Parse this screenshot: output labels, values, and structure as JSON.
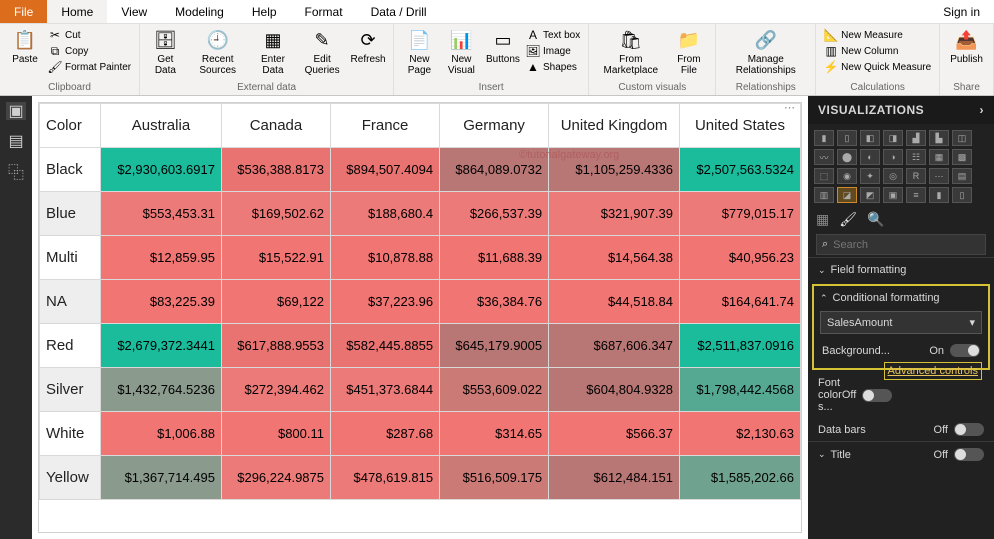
{
  "tabs": {
    "file": "File",
    "home": "Home",
    "view": "View",
    "modeling": "Modeling",
    "help": "Help",
    "format": "Format",
    "datadrill": "Data / Drill",
    "signin": "Sign in"
  },
  "ribbon": {
    "clipboard": {
      "paste": "Paste",
      "cut": "Cut",
      "copy": "Copy",
      "painter": "Format Painter",
      "label": "Clipboard"
    },
    "external": {
      "getdata": "Get\nData",
      "recent": "Recent\nSources",
      "enter": "Enter\nData",
      "edit": "Edit\nQueries",
      "refresh": "Refresh",
      "label": "External data"
    },
    "insert": {
      "newpage": "New\nPage",
      "newvisual": "New\nVisual",
      "buttons": "Buttons",
      "textbox": "Text box",
      "image": "Image",
      "shapes": "Shapes",
      "label": "Insert"
    },
    "custom": {
      "marketplace": "From\nMarketplace",
      "fromfile": "From\nFile",
      "label": "Custom visuals"
    },
    "rel": {
      "manage": "Manage\nRelationships",
      "label": "Relationships"
    },
    "calc": {
      "measure": "New Measure",
      "column": "New Column",
      "quick": "New Quick Measure",
      "label": "Calculations"
    },
    "share": {
      "publish": "Publish",
      "label": "Share"
    }
  },
  "matrix": {
    "corner": "Color",
    "columns": [
      "Australia",
      "Canada",
      "France",
      "Germany",
      "United Kingdom",
      "United States"
    ],
    "rows": [
      {
        "label": "Black",
        "cells": [
          {
            "v": "$2,930,603.6917",
            "c": "#1abc9c"
          },
          {
            "v": "$536,388.8173",
            "c": "#e97371"
          },
          {
            "v": "$894,507.4094",
            "c": "#e97371"
          },
          {
            "v": "$864,089.0732",
            "c": "#b87775"
          },
          {
            "v": "$1,105,259.4336",
            "c": "#b87775"
          },
          {
            "v": "$2,507,563.5324",
            "c": "#1abc9c"
          }
        ]
      },
      {
        "label": "Blue",
        "cells": [
          {
            "v": "$553,453.31",
            "c": "#ec7a78"
          },
          {
            "v": "$169,502.62",
            "c": "#ec7a78"
          },
          {
            "v": "$188,680.4",
            "c": "#ec7a78"
          },
          {
            "v": "$266,537.39",
            "c": "#ec7a78"
          },
          {
            "v": "$321,907.39",
            "c": "#ec7a78"
          },
          {
            "v": "$779,015.17",
            "c": "#ec7a78"
          }
        ]
      },
      {
        "label": "Multi",
        "cells": [
          {
            "v": "$12,859.95",
            "c": "#f07573"
          },
          {
            "v": "$15,522.91",
            "c": "#f07573"
          },
          {
            "v": "$10,878.88",
            "c": "#f07573"
          },
          {
            "v": "$11,688.39",
            "c": "#f07573"
          },
          {
            "v": "$14,564.38",
            "c": "#f07573"
          },
          {
            "v": "$40,956.23",
            "c": "#f07573"
          }
        ]
      },
      {
        "label": "NA",
        "cells": [
          {
            "v": "$83,225.39",
            "c": "#f07573"
          },
          {
            "v": "$69,122",
            "c": "#f07573"
          },
          {
            "v": "$37,223.96",
            "c": "#f07573"
          },
          {
            "v": "$36,384.76",
            "c": "#f07573"
          },
          {
            "v": "$44,518.84",
            "c": "#f07573"
          },
          {
            "v": "$164,641.74",
            "c": "#f07573"
          }
        ]
      },
      {
        "label": "Red",
        "cells": [
          {
            "v": "$2,679,372.3441",
            "c": "#1abc9c"
          },
          {
            "v": "$617,888.9553",
            "c": "#e97371"
          },
          {
            "v": "$582,445.8855",
            "c": "#e97371"
          },
          {
            "v": "$645,179.9005",
            "c": "#b87775"
          },
          {
            "v": "$687,606.347",
            "c": "#b87775"
          },
          {
            "v": "$2,511,837.0916",
            "c": "#1abc9c"
          }
        ]
      },
      {
        "label": "Silver",
        "cells": [
          {
            "v": "$1,432,764.5236",
            "c": "#8a9a8d"
          },
          {
            "v": "$272,394.462",
            "c": "#ec7a78"
          },
          {
            "v": "$451,373.6844",
            "c": "#ec7a78"
          },
          {
            "v": "$553,609.022",
            "c": "#cc7a76"
          },
          {
            "v": "$604,804.9328",
            "c": "#b87775"
          },
          {
            "v": "$1,798,442.4568",
            "c": "#55a992"
          }
        ]
      },
      {
        "label": "White",
        "cells": [
          {
            "v": "$1,006.88",
            "c": "#f07573"
          },
          {
            "v": "$800.11",
            "c": "#f07573"
          },
          {
            "v": "$287.68",
            "c": "#f07573"
          },
          {
            "v": "$314.65",
            "c": "#f07573"
          },
          {
            "v": "$566.37",
            "c": "#f07573"
          },
          {
            "v": "$2,130.63",
            "c": "#f07573"
          }
        ]
      },
      {
        "label": "Yellow",
        "cells": [
          {
            "v": "$1,367,714.495",
            "c": "#8a9a8d"
          },
          {
            "v": "$296,224.9875",
            "c": "#ec7a78"
          },
          {
            "v": "$478,619.815",
            "c": "#ec7a78"
          },
          {
            "v": "$516,509.175",
            "c": "#cc7a76"
          },
          {
            "v": "$612,484.151",
            "c": "#b87775"
          },
          {
            "v": "$1,585,202.66",
            "c": "#6fa28f"
          }
        ]
      }
    ],
    "watermark": "©tutorialgateway.org"
  },
  "viz": {
    "header": "VISUALIZATIONS",
    "search": "Search",
    "field_formatting": "Field formatting",
    "cond_formatting": "Conditional formatting",
    "field": "SalesAmount",
    "bg_label": "Background...",
    "bg_state": "On",
    "adv": "Advanced controls",
    "fontcolor": "Font color s...",
    "databars": "Data bars",
    "title": "Title",
    "off": "Off",
    "on": "On"
  }
}
